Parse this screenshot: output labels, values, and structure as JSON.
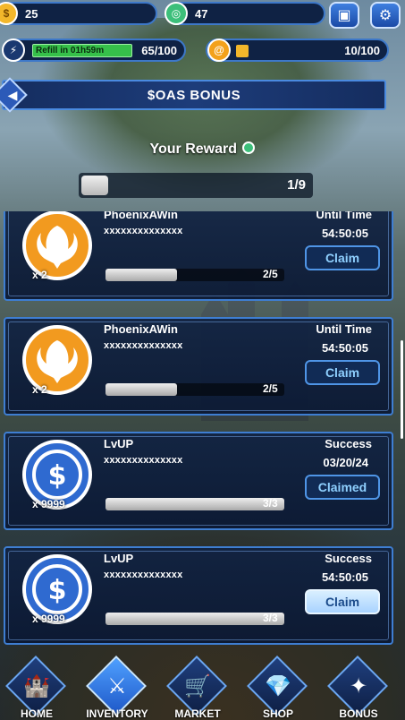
{
  "top": {
    "coins_value": "25",
    "gems_value": "47"
  },
  "energy": {
    "refill_label": "Refill in 01h59m",
    "value": "65/100",
    "fill_fraction": 0.65
  },
  "gold": {
    "value": "10/100",
    "fill_fraction": 0.1
  },
  "banner": {
    "title": "$OAS BONUS"
  },
  "reward": {
    "title": "Your Reward",
    "progress": "1/9",
    "fill_fraction": 0.111
  },
  "cards": [
    {
      "name": "PhoenixAWin",
      "sub": "xxxxxxxxxxxxxx",
      "qty": "x 2",
      "status": "Until Time",
      "time": "54:50:05",
      "progress": "2/5",
      "fill_fraction": 0.4,
      "button": "Claim",
      "icon": "phoenix-badge-icon"
    },
    {
      "name": "PhoenixAWin",
      "sub": "xxxxxxxxxxxxxx",
      "qty": "x 2",
      "status": "Until Time",
      "time": "54:50:05",
      "progress": "2/5",
      "fill_fraction": 0.4,
      "button": "Claim",
      "icon": "phoenix-badge-icon"
    },
    {
      "name": "LvUP",
      "sub": "xxxxxxxxxxxxxx",
      "qty": "x 9999",
      "status": "Success",
      "time": "03/20/24",
      "progress": "3/3",
      "fill_fraction": 1.0,
      "button": "Claimed",
      "icon": "usdc-coin-icon"
    },
    {
      "name": "LvUP",
      "sub": "xxxxxxxxxxxxxx",
      "qty": "x 9999",
      "status": "Success",
      "time": "54:50:05",
      "progress": "3/3",
      "fill_fraction": 1.0,
      "button": "Claim",
      "icon": "usdc-coin-icon"
    }
  ],
  "nav": [
    {
      "label": "HOME",
      "icon": "castle-icon"
    },
    {
      "label": "INVENTORY",
      "icon": "crossed-swords-icon"
    },
    {
      "label": "MARKET",
      "icon": "cart-icon"
    },
    {
      "label": "SHOP",
      "icon": "crystal-icon"
    },
    {
      "label": "BONUS",
      "icon": "bonus-icon"
    }
  ],
  "colors": {
    "accent_blue": "#3e7ed2",
    "energy_green": "#36c04a",
    "gold_yellow": "#f3b72b",
    "phoenix_orange": "#f29a1f",
    "usdc_blue": "#2f6ad0"
  }
}
